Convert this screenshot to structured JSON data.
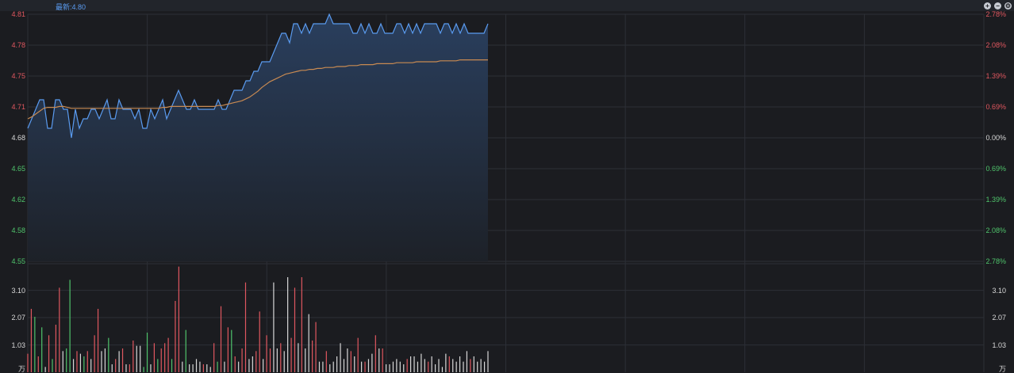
{
  "header": {
    "left_text": "",
    "latest_label": "最新:4.80",
    "controls": [
      {
        "name": "zoom-in-icon",
        "glyph": "+"
      },
      {
        "name": "zoom-out-icon",
        "glyph": "−"
      },
      {
        "name": "settings-icon",
        "glyph": "⚙"
      }
    ]
  },
  "colors": {
    "background": "#1b1c20",
    "grid": "#2c2f36",
    "price_line": "#5a9bf0",
    "avg_line": "#c88a52",
    "up": "#e0575f",
    "down": "#4fc36b",
    "neutral": "#d8d8d8",
    "area_top": "#2a3f5e",
    "area_bottom": "#1d2128"
  },
  "chart_data": [
    {
      "type": "line",
      "series": [
        {
          "role": "price",
          "values": [
            4.69,
            4.7,
            4.71,
            4.72,
            4.72,
            4.69,
            4.69,
            4.72,
            4.72,
            4.71,
            4.71,
            4.68,
            4.71,
            4.69,
            4.7,
            4.7,
            4.71,
            4.71,
            4.7,
            4.71,
            4.72,
            4.7,
            4.7,
            4.72,
            4.71,
            4.71,
            4.71,
            4.7,
            4.71,
            4.69,
            4.69,
            4.71,
            4.7,
            4.71,
            4.72,
            4.7,
            4.71,
            4.72,
            4.73,
            4.72,
            4.71,
            4.71,
            4.72,
            4.71,
            4.71,
            4.71,
            4.71,
            4.71,
            4.72,
            4.71,
            4.71,
            4.72,
            4.73,
            4.73,
            4.73,
            4.74,
            4.74,
            4.75,
            4.75,
            4.76,
            4.76,
            4.76,
            4.77,
            4.78,
            4.79,
            4.79,
            4.78,
            4.8,
            4.8,
            4.79,
            4.8,
            4.79,
            4.8,
            4.8,
            4.8,
            4.8,
            4.81,
            4.8,
            4.8,
            4.8,
            4.8,
            4.8,
            4.79,
            4.79,
            4.8,
            4.79,
            4.8,
            4.79,
            4.79,
            4.8,
            4.79,
            4.79,
            4.79,
            4.8,
            4.8,
            4.79,
            4.8,
            4.79,
            4.8,
            4.79,
            4.8,
            4.8,
            4.8,
            4.8,
            4.79,
            4.8,
            4.8,
            4.79,
            4.8,
            4.79,
            4.8,
            4.79,
            4.79,
            4.79,
            4.79,
            4.79,
            4.8
          ]
        },
        {
          "role": "average",
          "values": [
            4.7,
            4.702,
            4.705,
            4.708,
            4.711,
            4.712,
            4.712,
            4.712,
            4.713,
            4.713,
            4.712,
            4.711,
            4.711,
            4.711,
            4.711,
            4.711,
            4.711,
            4.711,
            4.711,
            4.711,
            4.711,
            4.711,
            4.711,
            4.711,
            4.711,
            4.711,
            4.711,
            4.711,
            4.711,
            4.711,
            4.711,
            4.711,
            4.711,
            4.711,
            4.712,
            4.712,
            4.713,
            4.713,
            4.713,
            4.713,
            4.713,
            4.713,
            4.713,
            4.713,
            4.713,
            4.713,
            4.713,
            4.713,
            4.714,
            4.714,
            4.715,
            4.716,
            4.717,
            4.718,
            4.719,
            4.721,
            4.723,
            4.726,
            4.729,
            4.733,
            4.736,
            4.739,
            4.741,
            4.743,
            4.745,
            4.747,
            4.748,
            4.749,
            4.75,
            4.751,
            4.751,
            4.752,
            4.752,
            4.753,
            4.753,
            4.754,
            4.754,
            4.754,
            4.755,
            4.755,
            4.755,
            4.756,
            4.756,
            4.756,
            4.757,
            4.757,
            4.757,
            4.757,
            4.758,
            4.758,
            4.758,
            4.758,
            4.758,
            4.759,
            4.759,
            4.759,
            4.759,
            4.759,
            4.76,
            4.76,
            4.76,
            4.76,
            4.76,
            4.76,
            4.761,
            4.761,
            4.761,
            4.761,
            4.761,
            4.762,
            4.762,
            4.762,
            4.762,
            4.762,
            4.762,
            4.762,
            4.762
          ]
        }
      ],
      "ylim": [
        4.55,
        4.81
      ],
      "y_ticks": [
        "4.81",
        "4.78",
        "4.75",
        "4.71",
        "4.68",
        "4.65",
        "4.62",
        "4.58",
        "4.55"
      ],
      "y_tick_colors": [
        "up",
        "up",
        "up",
        "up",
        "neutral",
        "down",
        "down",
        "down",
        "down"
      ],
      "y2_ticks": [
        "2.78%",
        "2.08%",
        "1.39%",
        "0.69%",
        "0.00%",
        "0.69%",
        "1.39%",
        "2.08%",
        "2.78%"
      ],
      "y2_tick_colors": [
        "up",
        "up",
        "up",
        "up",
        "neutral",
        "down",
        "down",
        "down",
        "down"
      ],
      "reference_price": 4.68,
      "grid": true,
      "total_slots": 242
    },
    {
      "type": "bar",
      "unit_label": "万",
      "y_ticks": [
        "3.10",
        "2.07",
        "1.03"
      ],
      "ylim": [
        0,
        4.11
      ],
      "values": [
        0.7,
        2.4,
        2.1,
        0.6,
        1.7,
        0.2,
        1.4,
        0.5,
        1.8,
        3.2,
        0.8,
        0.9,
        3.5,
        0.5,
        0.8,
        0.7,
        0.6,
        0.8,
        0.5,
        1.4,
        2.4,
        0.8,
        0.9,
        1.3,
        0.3,
        0.5,
        0.8,
        0.9,
        0.3,
        0.3,
        1.2,
        1.0,
        1.0,
        0.2,
        1.5,
        0.3,
        1.1,
        0.5,
        0.9,
        1.1,
        1.3,
        0.5,
        2.7,
        4.0,
        0.4,
        1.6,
        0.3,
        0.3,
        0.5,
        0.4,
        0.3,
        0.3,
        0.2,
        1.1,
        0.4,
        2.5,
        0.4,
        1.7,
        1.6,
        0.6,
        0.4,
        0.9,
        3.4,
        0.5,
        0.6,
        0.8,
        2.3,
        0.5,
        1.4,
        0.9,
        3.4,
        0.9,
        1.1,
        0.8,
        3.6,
        1.3,
        3.2,
        1.1,
        3.6,
        0.9,
        2.2,
        1.2,
        1.9,
        0.4,
        0.4,
        0.8,
        0.3,
        0.4,
        0.6,
        1.1,
        0.5,
        0.9,
        0.8,
        0.6,
        1.3,
        0.4,
        0.4,
        0.5,
        0.7,
        1.4,
        0.9,
        0.9,
        0.3,
        0.3,
        0.4,
        0.5,
        0.4,
        0.3,
        0.5,
        0.6,
        0.6,
        0.4,
        0.7,
        0.5,
        0.4,
        0.6,
        0.3,
        0.5,
        0.2,
        0.7,
        0.6,
        0.5,
        0.4,
        0.6,
        0.4,
        0.8,
        0.5,
        0.6,
        0.4,
        0.5,
        0.4,
        0.8
      ],
      "colors": [
        "up",
        "up",
        "down",
        "up",
        "down",
        "neutral",
        "up",
        "down",
        "up",
        "up",
        "neutral",
        "down",
        "down",
        "neutral",
        "up",
        "neutral",
        "down",
        "up",
        "neutral",
        "up",
        "up",
        "neutral",
        "neutral",
        "down",
        "neutral",
        "up",
        "neutral",
        "up",
        "neutral",
        "up",
        "up",
        "neutral",
        "neutral",
        "down",
        "down",
        "neutral",
        "up",
        "down",
        "up",
        "up",
        "up",
        "down",
        "up",
        "up",
        "neutral",
        "down",
        "neutral",
        "neutral",
        "neutral",
        "neutral",
        "up",
        "neutral",
        "neutral",
        "up",
        "down",
        "up",
        "neutral",
        "up",
        "down",
        "up",
        "neutral",
        "up",
        "up",
        "neutral",
        "neutral",
        "up",
        "up",
        "neutral",
        "up",
        "up",
        "neutral",
        "neutral",
        "up",
        "neutral",
        "neutral",
        "up",
        "up",
        "neutral",
        "up",
        "neutral",
        "neutral",
        "up",
        "up",
        "neutral",
        "neutral",
        "up",
        "neutral",
        "neutral",
        "neutral",
        "neutral",
        "neutral",
        "neutral",
        "up",
        "neutral",
        "up",
        "neutral",
        "up",
        "neutral",
        "neutral",
        "up",
        "neutral",
        "up",
        "neutral",
        "neutral",
        "neutral",
        "neutral",
        "neutral",
        "neutral",
        "up",
        "neutral",
        "neutral",
        "neutral",
        "neutral",
        "neutral",
        "up",
        "neutral",
        "neutral",
        "neutral",
        "neutral",
        "neutral",
        "up",
        "neutral",
        "neutral",
        "neutral",
        "neutral",
        "neutral",
        "up",
        "neutral",
        "neutral",
        "neutral",
        "neutral",
        "neutral",
        "up",
        "neutral"
      ],
      "grid": true
    }
  ]
}
